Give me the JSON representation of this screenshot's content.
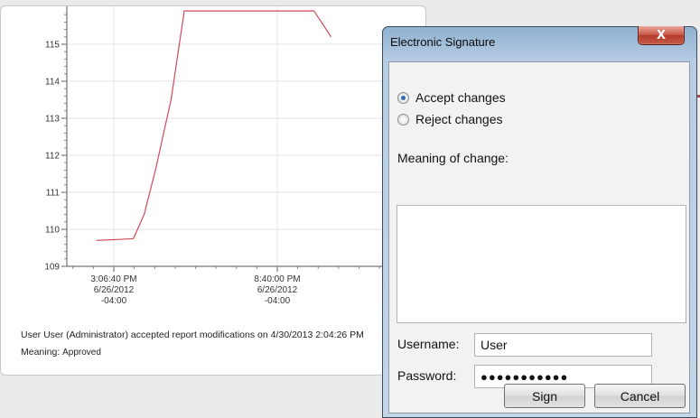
{
  "chart_data": {
    "type": "line",
    "title": "",
    "xlabel": "",
    "ylabel": "",
    "ylim": [
      109,
      116
    ],
    "y_ticks": [
      "109",
      "110",
      "111",
      "112",
      "113",
      "114",
      "115"
    ],
    "x_ticks": [
      {
        "time": "3:06:40 PM",
        "date": "6/26/2012",
        "tz": "-04:00"
      },
      {
        "time": "8:40:00 PM",
        "date": "6/26/2012",
        "tz": "-04:00"
      }
    ],
    "grid": true,
    "line_color": "#d04a5b",
    "series": [
      {
        "points": [
          {
            "x": "2:30 PM",
            "y": 109.7
          },
          {
            "x": "3:05 PM",
            "y": 109.72
          },
          {
            "x": "3:46 PM",
            "y": 109.75
          },
          {
            "x": "4:08 PM",
            "y": 110.4
          },
          {
            "x": "4:31 PM",
            "y": 111.6
          },
          {
            "x": "5:03 PM",
            "y": 113.5
          },
          {
            "x": "5:30 PM",
            "y": 115.9
          },
          {
            "x": "9:55 PM",
            "y": 115.9
          },
          {
            "x": "10:30 PM",
            "y": 115.2
          }
        ]
      }
    ]
  },
  "report": {
    "audit_text": "User User (Administrator) accepted report modifications on 4/30/2013 2:04:26 PM",
    "meaning_label": "Meaning:",
    "meaning_value": "Approved"
  },
  "dialog": {
    "title": "Electronic Signature",
    "close_glyph": "X",
    "options": [
      {
        "label": "Accept changes",
        "selected": true
      },
      {
        "label": "Reject changes",
        "selected": false
      }
    ],
    "meaning_label": "Meaning of change:",
    "meaning_value": "",
    "username_label": "Username:",
    "username_value": "User",
    "password_label": "Password:",
    "password_value": "●●●●●●●●●●●",
    "sign_label": "Sign",
    "cancel_label": "Cancel"
  },
  "colors": {
    "accent_red": "#a94b50",
    "radio_selected": "#2f6fb3"
  }
}
